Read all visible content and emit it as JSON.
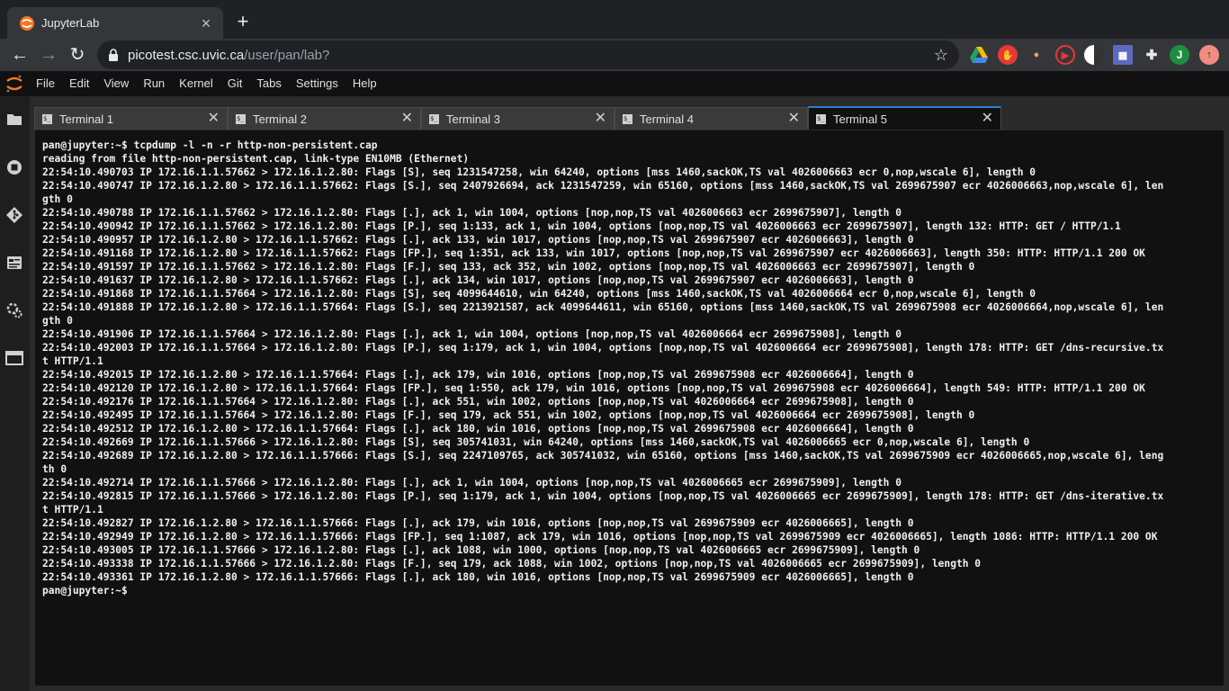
{
  "browser": {
    "tab_title": "JupyterLab",
    "url_host": "picotest.csc.uvic.ca",
    "url_path": "/user/pan/lab?",
    "profile_initial": "J"
  },
  "menubar": {
    "items": [
      "File",
      "Edit",
      "View",
      "Run",
      "Kernel",
      "Git",
      "Tabs",
      "Settings",
      "Help"
    ]
  },
  "sidebar": {
    "icons": [
      "folder-icon",
      "running-icon",
      "git-icon",
      "property-inspector-icon",
      "extension-icon",
      "tabs-icon"
    ]
  },
  "dock": {
    "tabs": [
      {
        "label": "Terminal 1",
        "active": false
      },
      {
        "label": "Terminal 2",
        "active": false
      },
      {
        "label": "Terminal 3",
        "active": false
      },
      {
        "label": "Terminal 4",
        "active": false
      },
      {
        "label": "Terminal 5",
        "active": true
      }
    ]
  },
  "terminal": {
    "lines": [
      "pan@jupyter:~$ tcpdump -l -n -r http-non-persistent.cap",
      "reading from file http-non-persistent.cap, link-type EN10MB (Ethernet)",
      "22:54:10.490703 IP 172.16.1.1.57662 > 172.16.1.2.80: Flags [S], seq 1231547258, win 64240, options [mss 1460,sackOK,TS val 4026006663 ecr 0,nop,wscale 6], length 0",
      "22:54:10.490747 IP 172.16.1.2.80 > 172.16.1.1.57662: Flags [S.], seq 2407926694, ack 1231547259, win 65160, options [mss 1460,sackOK,TS val 2699675907 ecr 4026006663,nop,wscale 6], len",
      "gth 0",
      "22:54:10.490788 IP 172.16.1.1.57662 > 172.16.1.2.80: Flags [.], ack 1, win 1004, options [nop,nop,TS val 4026006663 ecr 2699675907], length 0",
      "22:54:10.490942 IP 172.16.1.1.57662 > 172.16.1.2.80: Flags [P.], seq 1:133, ack 1, win 1004, options [nop,nop,TS val 4026006663 ecr 2699675907], length 132: HTTP: GET / HTTP/1.1",
      "22:54:10.490957 IP 172.16.1.2.80 > 172.16.1.1.57662: Flags [.], ack 133, win 1017, options [nop,nop,TS val 2699675907 ecr 4026006663], length 0",
      "22:54:10.491168 IP 172.16.1.2.80 > 172.16.1.1.57662: Flags [FP.], seq 1:351, ack 133, win 1017, options [nop,nop,TS val 2699675907 ecr 4026006663], length 350: HTTP: HTTP/1.1 200 OK",
      "22:54:10.491597 IP 172.16.1.1.57662 > 172.16.1.2.80: Flags [F.], seq 133, ack 352, win 1002, options [nop,nop,TS val 4026006663 ecr 2699675907], length 0",
      "22:54:10.491637 IP 172.16.1.2.80 > 172.16.1.1.57662: Flags [.], ack 134, win 1017, options [nop,nop,TS val 2699675907 ecr 4026006663], length 0",
      "22:54:10.491868 IP 172.16.1.1.57664 > 172.16.1.2.80: Flags [S], seq 4099644610, win 64240, options [mss 1460,sackOK,TS val 4026006664 ecr 0,nop,wscale 6], length 0",
      "22:54:10.491888 IP 172.16.1.2.80 > 172.16.1.1.57664: Flags [S.], seq 2213921587, ack 4099644611, win 65160, options [mss 1460,sackOK,TS val 2699675908 ecr 4026006664,nop,wscale 6], len",
      "gth 0",
      "22:54:10.491906 IP 172.16.1.1.57664 > 172.16.1.2.80: Flags [.], ack 1, win 1004, options [nop,nop,TS val 4026006664 ecr 2699675908], length 0",
      "22:54:10.492003 IP 172.16.1.1.57664 > 172.16.1.2.80: Flags [P.], seq 1:179, ack 1, win 1004, options [nop,nop,TS val 4026006664 ecr 2699675908], length 178: HTTP: GET /dns-recursive.tx",
      "t HTTP/1.1",
      "22:54:10.492015 IP 172.16.1.2.80 > 172.16.1.1.57664: Flags [.], ack 179, win 1016, options [nop,nop,TS val 2699675908 ecr 4026006664], length 0",
      "22:54:10.492120 IP 172.16.1.2.80 > 172.16.1.1.57664: Flags [FP.], seq 1:550, ack 179, win 1016, options [nop,nop,TS val 2699675908 ecr 4026006664], length 549: HTTP: HTTP/1.1 200 OK",
      "22:54:10.492176 IP 172.16.1.1.57664 > 172.16.1.2.80: Flags [.], ack 551, win 1002, options [nop,nop,TS val 4026006664 ecr 2699675908], length 0",
      "22:54:10.492495 IP 172.16.1.1.57664 > 172.16.1.2.80: Flags [F.], seq 179, ack 551, win 1002, options [nop,nop,TS val 4026006664 ecr 2699675908], length 0",
      "22:54:10.492512 IP 172.16.1.2.80 > 172.16.1.1.57664: Flags [.], ack 180, win 1016, options [nop,nop,TS val 2699675908 ecr 4026006664], length 0",
      "22:54:10.492669 IP 172.16.1.1.57666 > 172.16.1.2.80: Flags [S], seq 305741031, win 64240, options [mss 1460,sackOK,TS val 4026006665 ecr 0,nop,wscale 6], length 0",
      "22:54:10.492689 IP 172.16.1.2.80 > 172.16.1.1.57666: Flags [S.], seq 2247109765, ack 305741032, win 65160, options [mss 1460,sackOK,TS val 2699675909 ecr 4026006665,nop,wscale 6], leng",
      "th 0",
      "22:54:10.492714 IP 172.16.1.1.57666 > 172.16.1.2.80: Flags [.], ack 1, win 1004, options [nop,nop,TS val 4026006665 ecr 2699675909], length 0",
      "22:54:10.492815 IP 172.16.1.1.57666 > 172.16.1.2.80: Flags [P.], seq 1:179, ack 1, win 1004, options [nop,nop,TS val 4026006665 ecr 2699675909], length 178: HTTP: GET /dns-iterative.tx",
      "t HTTP/1.1",
      "22:54:10.492827 IP 172.16.1.2.80 > 172.16.1.1.57666: Flags [.], ack 179, win 1016, options [nop,nop,TS val 2699675909 ecr 4026006665], length 0",
      "22:54:10.492949 IP 172.16.1.2.80 > 172.16.1.1.57666: Flags [FP.], seq 1:1087, ack 179, win 1016, options [nop,nop,TS val 2699675909 ecr 4026006665], length 1086: HTTP: HTTP/1.1 200 OK",
      "22:54:10.493005 IP 172.16.1.1.57666 > 172.16.1.2.80: Flags [.], ack 1088, win 1000, options [nop,nop,TS val 4026006665 ecr 2699675909], length 0",
      "22:54:10.493338 IP 172.16.1.1.57666 > 172.16.1.2.80: Flags [F.], seq 179, ack 1088, win 1002, options [nop,nop,TS val 4026006665 ecr 2699675909], length 0",
      "22:54:10.493361 IP 172.16.1.2.80 > 172.16.1.1.57666: Flags [.], ack 180, win 1016, options [nop,nop,TS val 2699675909 ecr 4026006665], length 0",
      "pan@jupyter:~$ "
    ]
  },
  "colors": {
    "accent": "#2f7dd1",
    "jupyter_orange": "#f37726",
    "terminal_bg": "#111111",
    "terminal_fg": "#f0f0f0"
  }
}
